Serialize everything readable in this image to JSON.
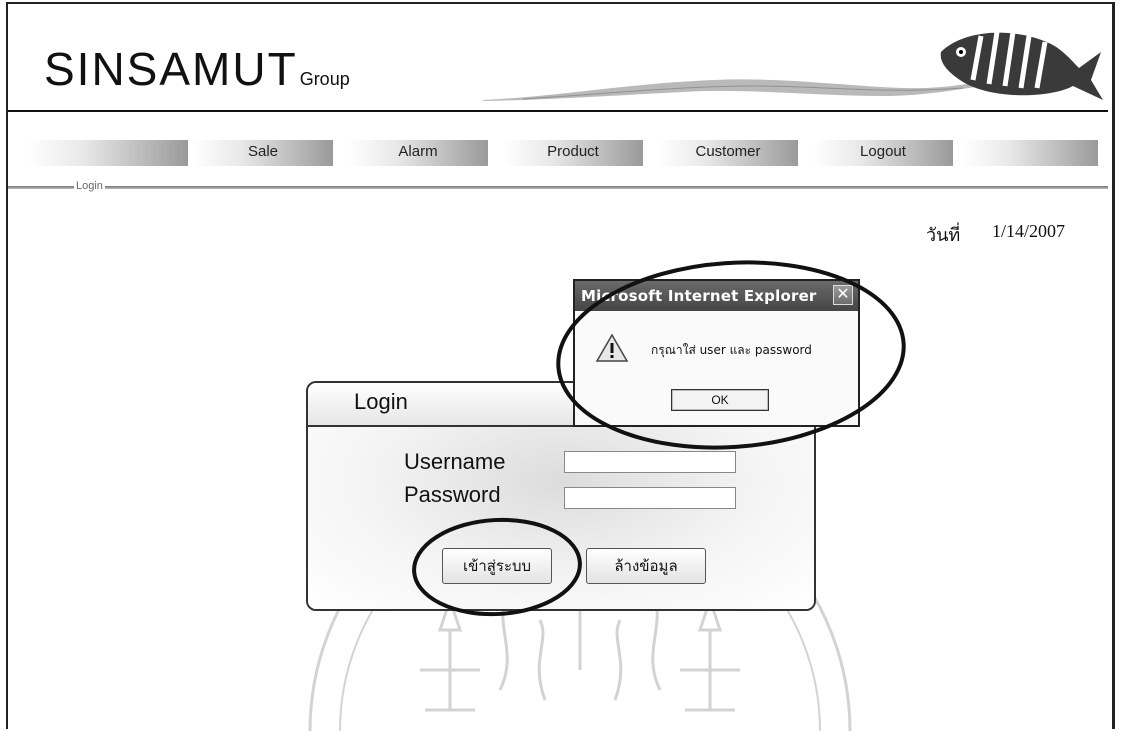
{
  "header": {
    "brand": "SINSAMUT",
    "brand_sub": "Group"
  },
  "nav": {
    "items": [
      {
        "label": ""
      },
      {
        "label": "Sale"
      },
      {
        "label": "Alarm"
      },
      {
        "label": "Product"
      },
      {
        "label": "Customer"
      },
      {
        "label": "Logout"
      },
      {
        "label": ""
      }
    ]
  },
  "breadcrumb": "Login",
  "date": {
    "label": "วันที่",
    "value": "1/14/2007"
  },
  "login": {
    "title": "Login",
    "username_label": "Username",
    "password_label": "Password",
    "username_value": "",
    "password_value": "",
    "submit_label": "เข้าสู่ระบบ",
    "clear_label": "ล้างข้อมูล"
  },
  "dialog": {
    "title": "Microsoft Internet Explorer",
    "message": "กรุณาใส่ user และ password",
    "ok_label": "OK",
    "icon": "warning-icon"
  },
  "colors": {
    "nav_dark": "#9a9a9a",
    "titlebar": "#454545",
    "annotation": "#111111"
  }
}
